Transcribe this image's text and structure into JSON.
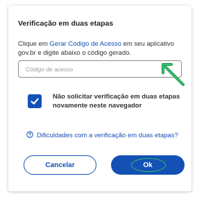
{
  "dialog": {
    "title": "Verificação em duas etapas",
    "desc_prefix": "Clique em ",
    "desc_link": "Gerar Código de Acesso",
    "desc_suffix": " em seu aplicativo gov.br e digite abaixo o código gerado.",
    "input_placeholder": "Código de acesso",
    "input_value": "",
    "remember_label": "Não solicitar verificação em duas etapas novamente neste navegador",
    "remember_checked": true,
    "help_link": "Dificuldades com a verificação em duas etapas?",
    "cancel_label": "Cancelar",
    "ok_label": "Ok"
  },
  "colors": {
    "primary": "#1351b4",
    "annotation": "#2fc06a"
  },
  "icons": {
    "checkbox": "checkmark-icon",
    "help": "question-circle-icon",
    "annotation": "arrow-pointer-icon"
  }
}
